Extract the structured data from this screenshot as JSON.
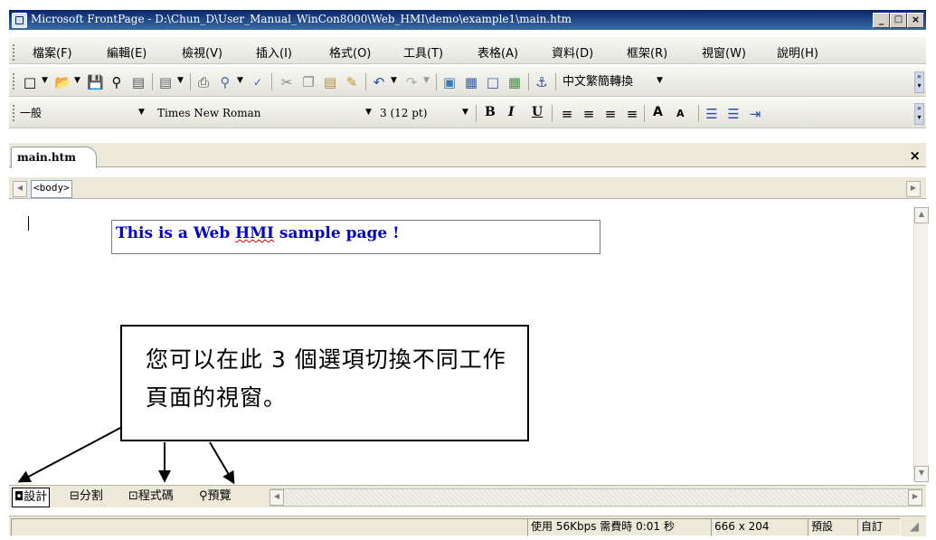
{
  "window": {
    "title": "Microsoft FrontPage - D:\\Chun_D\\User_Manual_WinCon8000\\Web_HMI\\demo\\example1\\main.htm",
    "minimize": "_",
    "maximize": "□",
    "close": "×"
  },
  "menu": [
    "檔案(F)",
    "編輯(E)",
    "檢視(V)",
    "插入(I)",
    "格式(O)",
    "工具(T)",
    "表格(A)",
    "資料(D)",
    "框架(R)",
    "視窗(W)",
    "說明(H)"
  ],
  "toolbar": {
    "chinese_convert": "中文繁簡轉換"
  },
  "format": {
    "style": "一般",
    "font": "Times New Roman",
    "size": "3  (12 pt)",
    "bold": "B",
    "italic": "I",
    "underline": "U",
    "grow": "A",
    "shrink": "A"
  },
  "document": {
    "tab": "main.htm",
    "close": "×",
    "quick_tag": "<body>",
    "sample_text_before": "This is a Web ",
    "sample_text_misspelled": "HMI",
    "sample_text_after": " sample page !"
  },
  "callout": {
    "text": "您可以在此 3 個選項切換不同工作頁面的視窗。"
  },
  "view_tabs": [
    "設計",
    "分割",
    "程式碼",
    "預覽"
  ],
  "view_tab_icons": [
    "design-view-icon",
    "split-view-icon",
    "code-view-icon",
    "preview-icon"
  ],
  "statusbar": {
    "speed": "使用 56Kbps 需費時 0:01 秒",
    "dimensions": "666 x 204",
    "default": "預設",
    "custom": "自訂"
  },
  "colors": {
    "title_bar": "#0a246a",
    "sample_text": "#0000cc",
    "chrome": "#ece9d8"
  }
}
